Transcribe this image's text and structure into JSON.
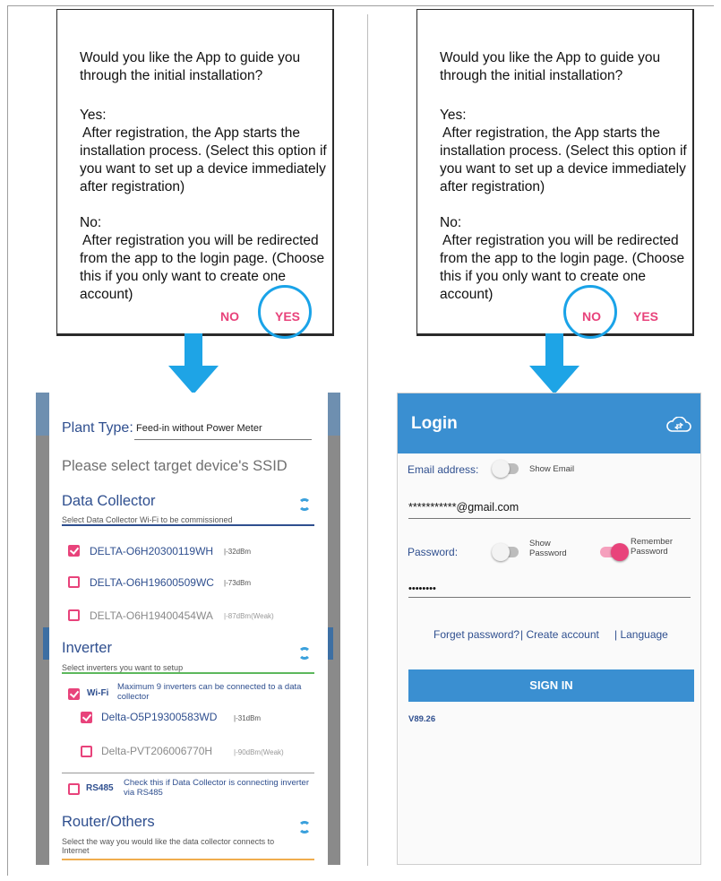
{
  "dialog": {
    "question": "Would you like the App to guide you through the initial installation?",
    "yes_title": "Yes:",
    "yes_body": "After registration, the App starts the installation process. (Select this option if you want to set up a device immediately after registration)",
    "no_title": "No:",
    "no_body": "After registration you will be redirected from the app to the login page. (Choose this if you only want to create one account)",
    "no_label": "NO",
    "yes_label": "YES"
  },
  "setup": {
    "plant_type_label": "Plant Type:",
    "plant_type_value": "Feed-in without Power Meter",
    "ssid_heading": "Please select target device's SSID",
    "data_collector": {
      "title": "Data Collector",
      "subtitle": "Select Data Collector Wi-Fi to be commissioned",
      "items": [
        {
          "name": "DELTA-O6H20300119WH",
          "signal": "|-32dBm",
          "checked": true
        },
        {
          "name": "DELTA-O6H19600509WC",
          "signal": "|-73dBm",
          "checked": false
        },
        {
          "name": "DELTA-O6H19400454WA",
          "signal": "|-87dBm(Weak)",
          "checked": false
        }
      ]
    },
    "inverter": {
      "title": "Inverter",
      "subtitle": "Select inverters you want to setup",
      "wifi_label": "Wi-Fi",
      "wifi_note": "Maximum 9 inverters can be connected to a data collector",
      "items": [
        {
          "name": "Delta-O5P19300583WD",
          "signal": "|-31dBm",
          "checked": true
        },
        {
          "name": "Delta-PVT206006770H",
          "signal": "|-90dBm(Weak)",
          "checked": false
        }
      ],
      "rs485_label": "RS485",
      "rs485_note": "Check this if Data Collector is connecting inverter via RS485"
    },
    "router": {
      "title": "Router/Others",
      "subtitle": "Select the way you would like the data collector connects to Internet"
    }
  },
  "login": {
    "title": "Login",
    "email_label": "Email address:",
    "show_email": "Show Email",
    "email_value": "***********@gmail.com",
    "password_label": "Password:",
    "show_password": "Show Password",
    "remember_password": "Remember Password",
    "password_value": "••••••••",
    "forget_password": "Forget password?",
    "create_account": "| Create account",
    "language": "| Language",
    "sign_in": "SIGN IN",
    "version": "V89.26"
  },
  "colors": {
    "accent_pink": "#e8437b",
    "primary_blue": "#3a8fd1",
    "highlight_circle": "#1aa3e8"
  }
}
